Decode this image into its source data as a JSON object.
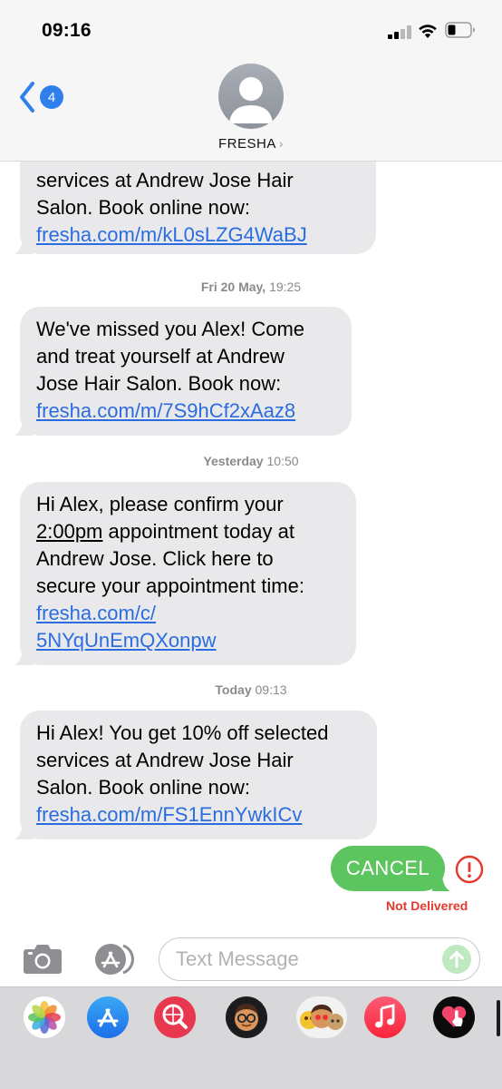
{
  "status_bar": {
    "time": "09:16"
  },
  "header": {
    "back_count": "4",
    "contact_name": "FRESHA",
    "chevron": "›"
  },
  "messages": [
    {
      "lines": [
        "services at Andrew Jose Hair",
        "Salon. Book online now:"
      ],
      "link": "fresha.com/m/kL0sLZG4WaBJ"
    },
    {
      "lines": [
        "We've missed you Alex! Come",
        "and treat yourself at Andrew",
        "Jose Hair Salon. Book now:"
      ],
      "link": "fresha.com/m/7S9hCf2xAaz8"
    },
    {
      "line1_pre": "Hi Alex, please confirm your",
      "line2_time": "2:00pm",
      "line2_post": " appointment today at",
      "lines": [
        "Andrew Jose. Click here to",
        "secure your appointment time:"
      ],
      "link_lines": [
        "fresha.com/c/",
        "5NYqUnEmQXonpw"
      ]
    },
    {
      "lines": [
        "Hi Alex! You get 10% off selected",
        "services at Andrew Jose Hair",
        "Salon. Book online now:"
      ],
      "link": "fresha.com/m/FS1EnnYwkICv"
    }
  ],
  "timestamps": [
    {
      "day": "Fri 20 May,",
      "time": " 19:25"
    },
    {
      "day": "Yesterday",
      "time": " 10:50"
    },
    {
      "day": "Today",
      "time": " 09:13"
    }
  ],
  "sent_message": {
    "text": "CANCEL",
    "status": "Not Delivered"
  },
  "input": {
    "placeholder": "Text Message"
  },
  "colors": {
    "incoming_bubble": "#e9e9eb",
    "sms_bubble": "#5dc560",
    "link": "#2b6de0",
    "error": "#e4392e"
  },
  "drawer_apps": [
    "photos-icon",
    "app-store-icon",
    "web-search-icon",
    "memoji-icon",
    "memoji-stickers-icon",
    "music-icon",
    "digital-touch-icon"
  ]
}
